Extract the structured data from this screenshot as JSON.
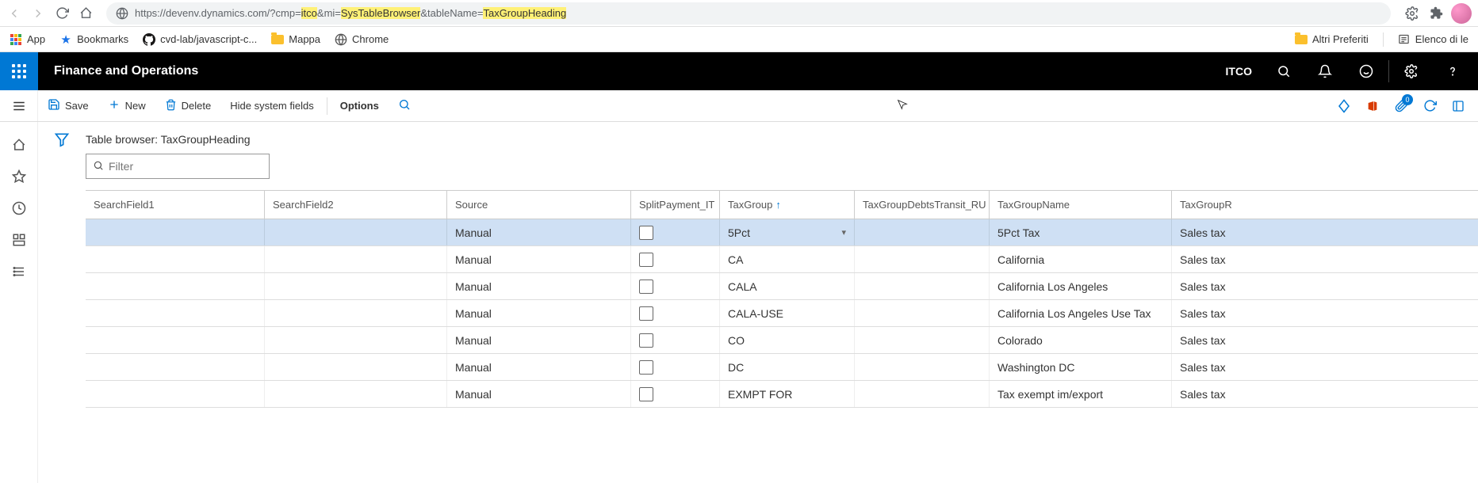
{
  "browser": {
    "url_prefix": "https://devenv.dynamics.com/?cmp=",
    "url_hl1": "itco",
    "url_mid1": "&mi=",
    "url_hl2": "SysTableBrowser",
    "url_mid2": "&tableName=",
    "url_hl3": "TaxGroupHeading"
  },
  "bookmarks": {
    "apps": "App",
    "bk1": "Bookmarks",
    "bk2": "cvd-lab/javascript-c...",
    "bk3": "Mappa",
    "bk4": "Chrome",
    "right1": "Altri Preferiti",
    "right2": "Elenco di le"
  },
  "header": {
    "title": "Finance and Operations",
    "company": "ITCO"
  },
  "actions": {
    "save": "Save",
    "new": "New",
    "delete": "Delete",
    "hide": "Hide system fields",
    "options": "Options",
    "badge": "0"
  },
  "page": {
    "title": "Table browser: TaxGroupHeading",
    "filter_placeholder": "Filter"
  },
  "columns": {
    "c0": "SearchField1",
    "c1": "SearchField2",
    "c2": "Source",
    "c3": "SplitPayment_IT",
    "c4": "TaxGroup",
    "c5": "TaxGroupDebtsTransit_RU",
    "c6": "TaxGroupName",
    "c7": "TaxGroupR"
  },
  "rows": [
    {
      "source": "Manual",
      "taxgroup": "5Pct",
      "name": "5Pct Tax",
      "r": "Sales tax"
    },
    {
      "source": "Manual",
      "taxgroup": "CA",
      "name": "California",
      "r": "Sales tax"
    },
    {
      "source": "Manual",
      "taxgroup": "CALA",
      "name": "California Los Angeles",
      "r": "Sales tax"
    },
    {
      "source": "Manual",
      "taxgroup": "CALA-USE",
      "name": "California  Los Angeles Use Tax",
      "r": "Sales tax"
    },
    {
      "source": "Manual",
      "taxgroup": "CO",
      "name": "Colorado",
      "r": "Sales tax"
    },
    {
      "source": "Manual",
      "taxgroup": "DC",
      "name": "Washington DC",
      "r": "Sales tax"
    },
    {
      "source": "Manual",
      "taxgroup": "EXMPT FOR",
      "name": "Tax exempt im/export",
      "r": "Sales tax"
    }
  ]
}
